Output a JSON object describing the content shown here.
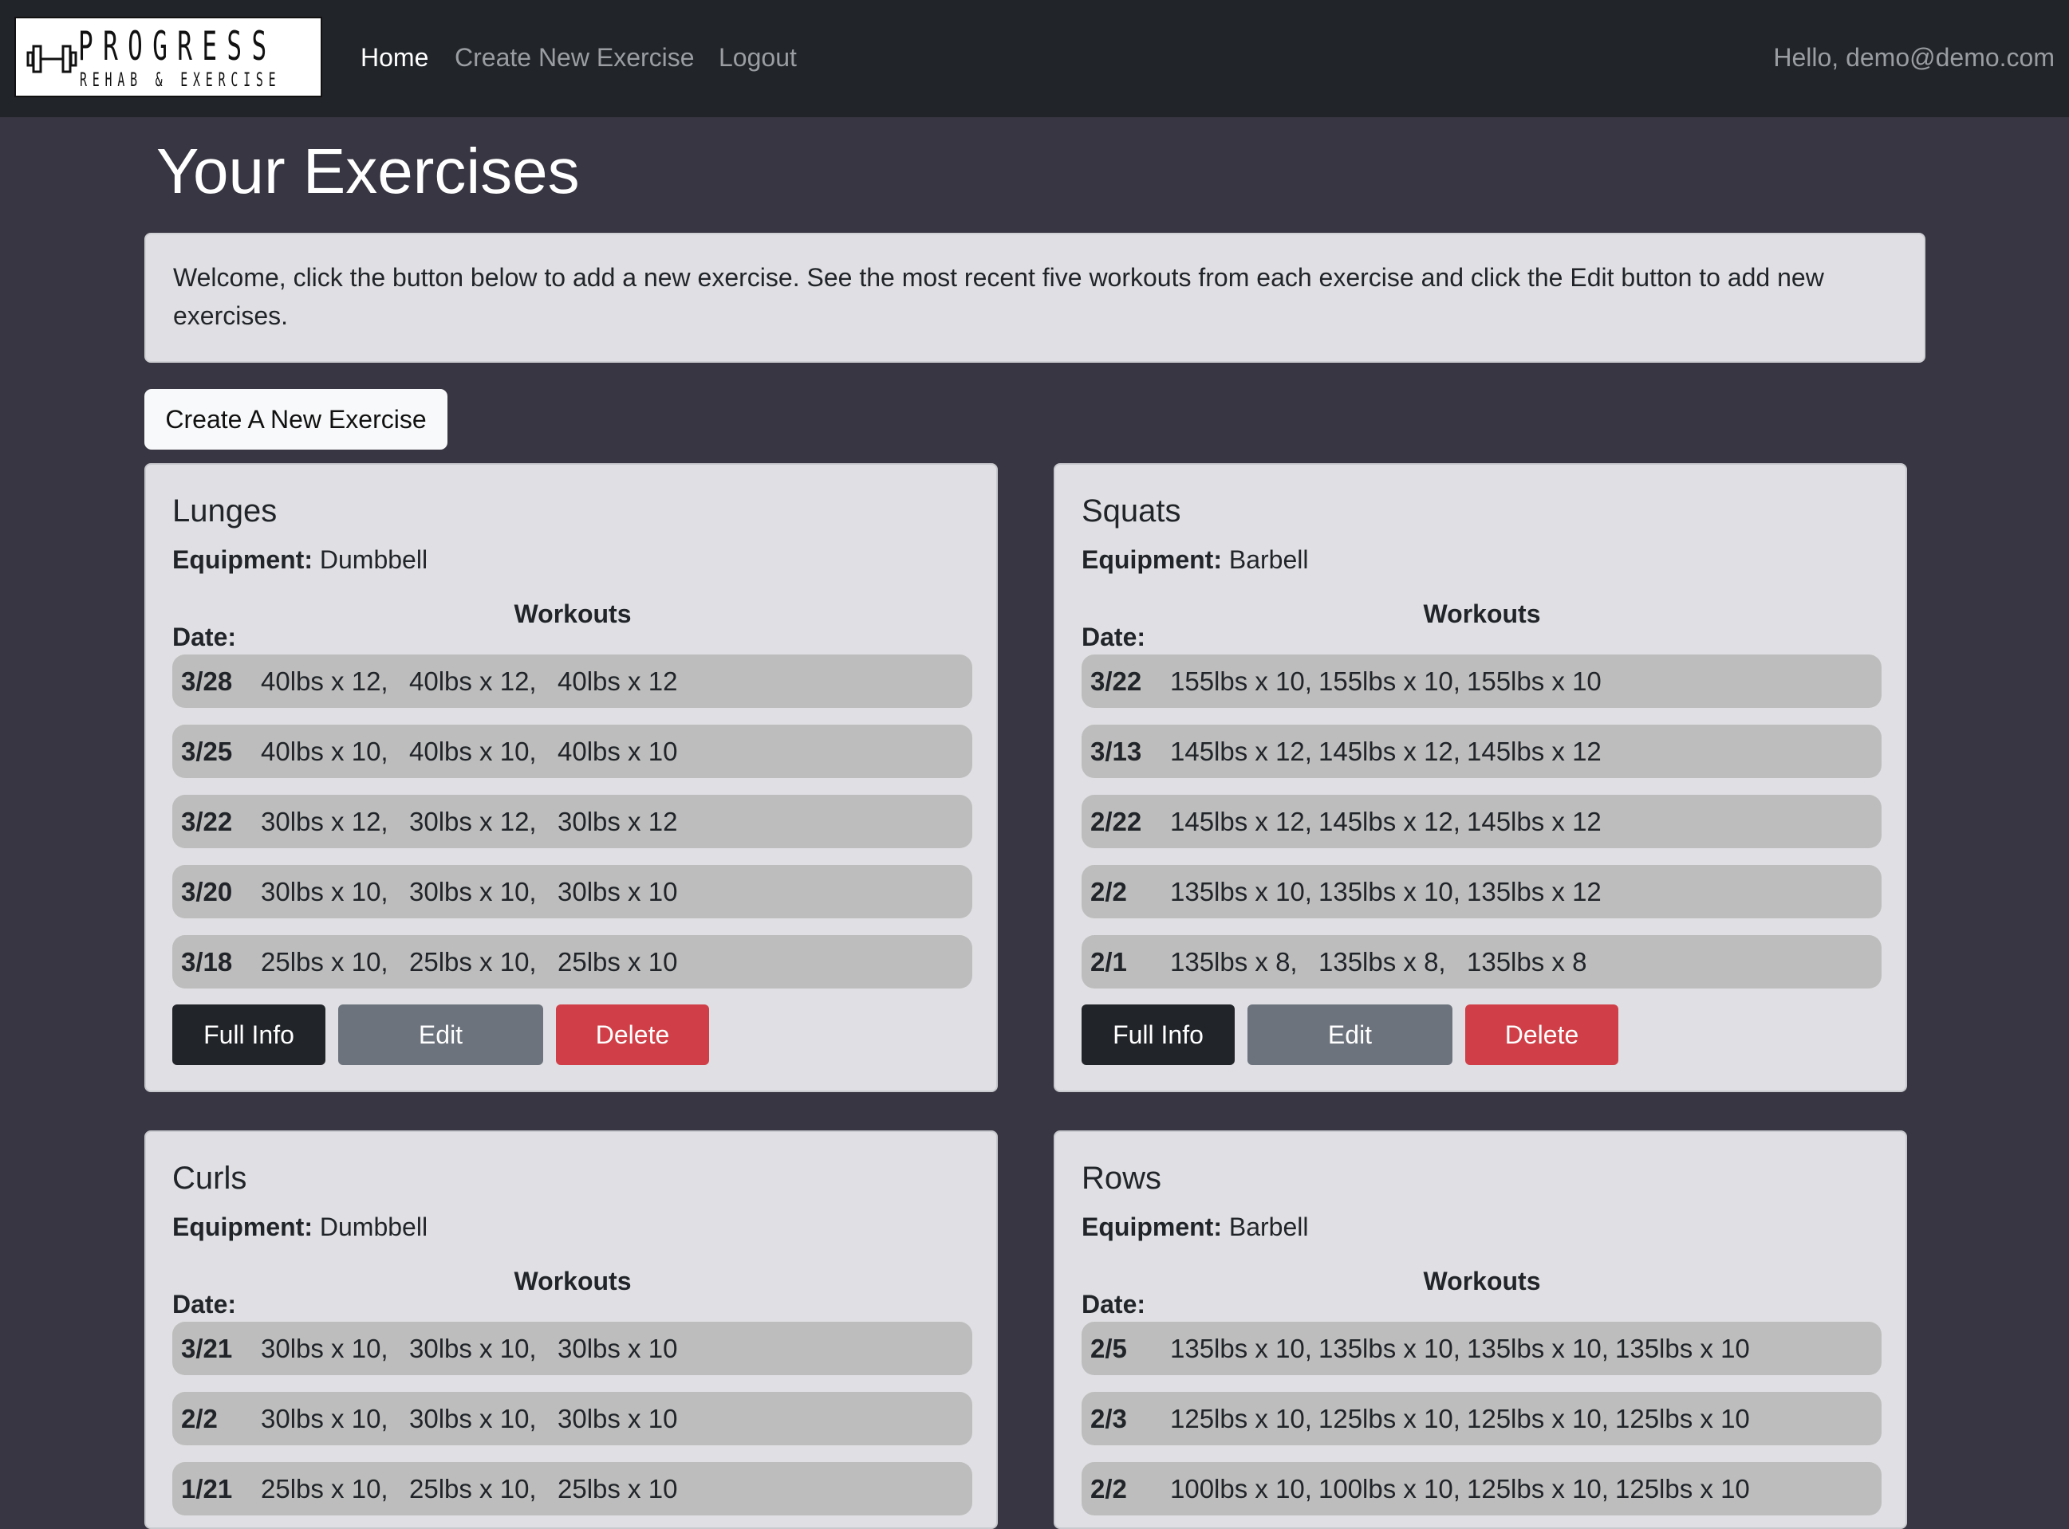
{
  "nav": {
    "logo_title": "PROGRESS",
    "logo_subtitle": "REHAB & EXERCISE",
    "home": "Home",
    "create": "Create New Exercise",
    "logout": "Logout",
    "greeting": "Hello, demo@demo.com"
  },
  "page": {
    "title": "Your Exercises",
    "welcome": "Welcome, click the button below to add a new exercise. See the most recent five workouts from each exercise and click the Edit button to add new exercises.",
    "create_button": "Create A New Exercise"
  },
  "labels": {
    "equipment": "Equipment:",
    "workouts": "Workouts",
    "date": "Date:",
    "full_info": "Full Info",
    "edit": "Edit",
    "delete": "Delete"
  },
  "exercises": [
    {
      "name": "Lunges",
      "equipment": "Dumbbell",
      "workouts": [
        {
          "date": "3/28",
          "sets": [
            "40lbs x 12,",
            "40lbs x 12,",
            "40lbs x 12"
          ]
        },
        {
          "date": "3/25",
          "sets": [
            "40lbs x 10,",
            "40lbs x 10,",
            "40lbs x 10"
          ]
        },
        {
          "date": "3/22",
          "sets": [
            "30lbs x 12,",
            "30lbs x 12,",
            "30lbs x 12"
          ]
        },
        {
          "date": "3/20",
          "sets": [
            "30lbs x 10,",
            "30lbs x 10,",
            "30lbs x 10"
          ]
        },
        {
          "date": "3/18",
          "sets": [
            "25lbs x 10,",
            "25lbs x 10,",
            "25lbs x 10"
          ]
        }
      ]
    },
    {
      "name": "Squats",
      "equipment": "Barbell",
      "workouts": [
        {
          "date": "3/22",
          "sets": [
            "155lbs x 10,",
            "155lbs x 10,",
            "155lbs x 10"
          ]
        },
        {
          "date": "3/13",
          "sets": [
            "145lbs x 12,",
            "145lbs x 12,",
            "145lbs x 12"
          ]
        },
        {
          "date": "2/22",
          "sets": [
            "145lbs x 12,",
            "145lbs x 12,",
            "145lbs x 12"
          ]
        },
        {
          "date": "2/2",
          "sets": [
            "135lbs x 10,",
            "135lbs x 10,",
            "135lbs x 12"
          ]
        },
        {
          "date": "2/1",
          "sets": [
            "135lbs x 8,",
            "135lbs x 8,",
            "135lbs x 8"
          ]
        }
      ]
    },
    {
      "name": "Curls",
      "equipment": "Dumbbell",
      "workouts": [
        {
          "date": "3/21",
          "sets": [
            "30lbs x 10,",
            "30lbs x 10,",
            "30lbs x 10"
          ]
        },
        {
          "date": "2/2",
          "sets": [
            "30lbs x 10,",
            "30lbs x 10,",
            "30lbs x 10"
          ]
        },
        {
          "date": "1/21",
          "sets": [
            "25lbs x 10,",
            "25lbs x 10,",
            "25lbs x 10"
          ]
        }
      ]
    },
    {
      "name": "Rows",
      "equipment": "Barbell",
      "workouts": [
        {
          "date": "2/5",
          "sets": [
            "135lbs x 10,",
            "135lbs x 10,",
            "135lbs x 10,",
            "135lbs x 10"
          ]
        },
        {
          "date": "2/3",
          "sets": [
            "125lbs x 10,",
            "125lbs x 10,",
            "125lbs x 10,",
            "125lbs x 10"
          ]
        },
        {
          "date": "2/2",
          "sets": [
            "100lbs x 10,",
            "100lbs x 10,",
            "125lbs x 10,",
            "125lbs x 10"
          ]
        }
      ]
    }
  ]
}
